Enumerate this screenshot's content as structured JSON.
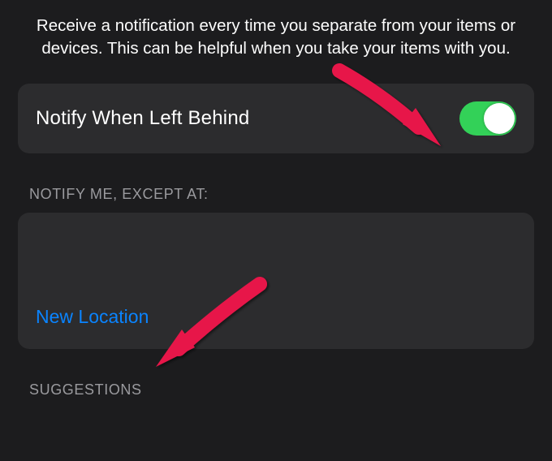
{
  "description": "Receive a notification every time you separate from your items or devices. This can be helpful when you take your items with you.",
  "notify_row": {
    "label": "Notify When Left Behind",
    "toggle_on": true
  },
  "sections": {
    "except_at": {
      "header": "NOTIFY ME, EXCEPT AT:",
      "new_location_label": "New Location"
    },
    "suggestions": {
      "header": "SUGGESTIONS"
    }
  },
  "colors": {
    "toggle_on": "#33d158",
    "link": "#0a84ff",
    "arrow": "#e7174a"
  }
}
